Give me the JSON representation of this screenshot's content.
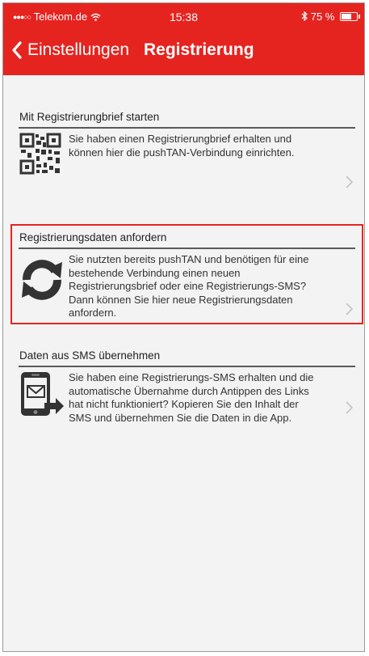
{
  "status_bar": {
    "carrier": "Telekom.de",
    "time": "15:38",
    "battery": "75 %",
    "battery_level": 0.75
  },
  "nav": {
    "back_label": "Einstellungen",
    "title": "Registrierung"
  },
  "sections": [
    {
      "title": "Mit Registrierungbrief starten",
      "text": "Sie haben einen Registrierungbrief erhalten und können hier die pushTAN-Verbindung einrichten.",
      "icon": "qr-code-icon"
    },
    {
      "title": "Registrierungsdaten anfordern",
      "text": "Sie nutzten bereits pushTAN und benötigen für eine bestehende Verbindung einen neuen Registrierungsbrief oder eine Registrierungs-SMS? Dann können Sie hier neue Registrierungsdaten anfordern.",
      "icon": "refresh-icon",
      "highlighted": true
    },
    {
      "title": "Daten aus SMS übernehmen",
      "text": "Sie haben eine Registrierungs-SMS erhalten und die automatische Übernahme durch Antippen des Links hat nicht funktioniert? Kopieren Sie den Inhalt der SMS und übernehmen Sie die Daten in die App.",
      "icon": "sms-phone-icon"
    }
  ],
  "colors": {
    "brand_red": "#e52420",
    "background": "#f3f3f3"
  }
}
